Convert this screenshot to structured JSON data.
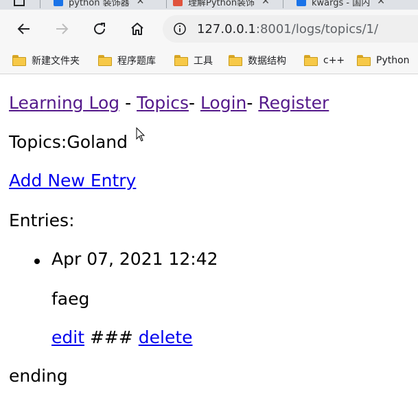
{
  "tabs": [
    {
      "label": "python 装饰器",
      "icon": "bing-icon",
      "color": "#1a73e8"
    },
    {
      "label": "理解Python装饰",
      "icon": "csdn-icon",
      "color": "#e0533d"
    },
    {
      "label": "kwargs - 国内",
      "icon": "bing-icon",
      "color": "#1a73e8"
    }
  ],
  "address_bar": {
    "host": "127.0.0.1",
    "path": ":8001/logs/topics/1/"
  },
  "bookmarks": [
    {
      "label": "新建文件夹"
    },
    {
      "label": "程序题库"
    },
    {
      "label": "工具"
    },
    {
      "label": "数据结构"
    },
    {
      "label": "c++"
    },
    {
      "label": "Python"
    }
  ],
  "page": {
    "nav": {
      "learning_log": "Learning Log",
      "sep1": " - ",
      "topics": "Topics",
      "sep2": "- ",
      "login": "Login",
      "sep3": "- ",
      "register": "Register"
    },
    "topic_prefix": "Topics:",
    "topic_name": "Goland",
    "add_entry": "Add New Entry",
    "entries_label": "Entries:",
    "entries": [
      {
        "date": "Apr 07, 2021 12:42",
        "text": "faeg",
        "edit": "edit",
        "separator": " ### ",
        "delete": "delete"
      }
    ],
    "ending": "ending"
  },
  "colors": {
    "visited_link": "#551a8b",
    "link": "#0000ee",
    "folder": "#f7c948"
  }
}
